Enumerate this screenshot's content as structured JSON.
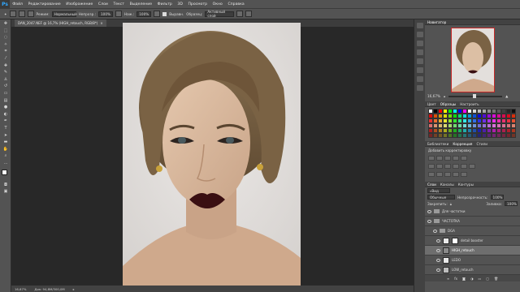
{
  "app": {
    "logo": "Ps"
  },
  "menu": [
    "Файл",
    "Редактирование",
    "Изображение",
    "Слои",
    "Текст",
    "Выделение",
    "Фильтр",
    "3D",
    "Просмотр",
    "Окно",
    "Справка"
  ],
  "options": {
    "mode_label": "Режим:",
    "mode_value": "Нормальный",
    "opacity_label": "Непрозр.:",
    "opacity_value": "100%",
    "pressure_label": "Наж.:",
    "pressure_value": "100%",
    "sample_label": "Образец:",
    "sample_value": "Активный слой",
    "align_label": "Выравн."
  },
  "document": {
    "tab_label": "DAN_2047.NEF @ 16,7% (HIGH_retouch, RGB/8*)",
    "close": "×"
  },
  "status": {
    "zoom": "16,67%",
    "doc_size": "Док: 94,8М/300,0М"
  },
  "navigator": {
    "title": "Навигатор",
    "zoom": "16,67%"
  },
  "swatches_panel": {
    "tabs": [
      "Цвет",
      "Образцы",
      "Настроить"
    ],
    "active": "Образцы"
  },
  "adjustments_panel": {
    "tabs": [
      "Библиотеки",
      "Коррекция",
      "Стили"
    ],
    "active": "Коррекция",
    "subtitle": "Добавить корректировку"
  },
  "layers_panel": {
    "tabs": [
      "Слои",
      "Каналы",
      "Контуры"
    ],
    "filter_label": "Вид",
    "blend_mode": "Обычные",
    "opacity_label": "Непрозрачность:",
    "opacity_value": "100%",
    "lock_label": "Закрепить:",
    "fill_label": "Заливка:",
    "fill_value": "100%",
    "layers": [
      {
        "name": "Для частотки",
        "type": "folder"
      },
      {
        "name": "ЧАСТОТКА",
        "type": "folder"
      },
      {
        "name": "DGA",
        "type": "folder"
      },
      {
        "name": "detail booster",
        "type": "layer"
      },
      {
        "name": "HIGH_retouch",
        "type": "layer"
      },
      {
        "name": "LEDO",
        "type": "layer"
      },
      {
        "name": "LOW_retouch",
        "type": "layer"
      }
    ]
  },
  "swatch_colors": [
    "#ffffff",
    "#000000",
    "#ff0000",
    "#ffff00",
    "#00ff00",
    "#00ffff",
    "#0000ff",
    "#ff00ff",
    "#f2f2f2",
    "#d9d9d9",
    "#bfbfbf",
    "#a6a6a6",
    "#8c8c8c",
    "#737373",
    "#595959",
    "#404040",
    "#262626",
    "#0d0d0d"
  ]
}
